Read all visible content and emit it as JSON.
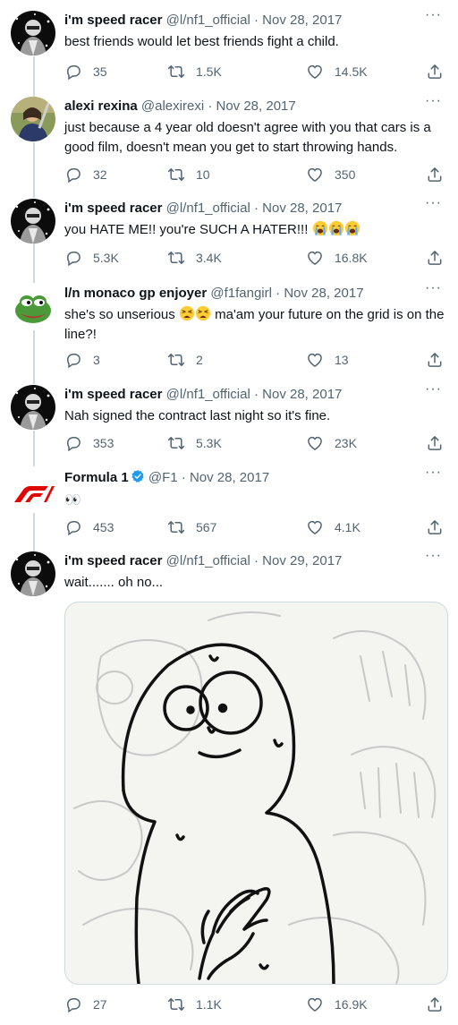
{
  "tweets": [
    {
      "name": "i'm speed racer",
      "handle": "@l/nf1_official",
      "sep": "·",
      "date": "Nov 28, 2017",
      "text": "best friends would let best friends fight a child.",
      "replies": "35",
      "retweets": "1.5K",
      "likes": "14.5K"
    },
    {
      "name": "alexi rexina",
      "handle": "@alexirexi",
      "sep": "·",
      "date": "Nov 28, 2017",
      "text": "just because a 4 year old doesn't agree with you that cars is a good film, doesn't mean you get to start throwing hands.",
      "replies": "32",
      "retweets": "10",
      "likes": "350"
    },
    {
      "name": "i'm speed racer",
      "handle": "@l/nf1_official",
      "sep": "·",
      "date": "Nov 28, 2017",
      "text": "you HATE ME!! you're SUCH A HATER!!!",
      "replies": "5.3K",
      "retweets": "3.4K",
      "likes": "16.8K"
    },
    {
      "name": "l/n monaco gp enjoyer",
      "handle": "@f1fangirl",
      "sep": "·",
      "date": "Nov 28, 2017",
      "text_a": "she's so unserious",
      "text_b": "ma'am your future on the grid is on the line?!",
      "replies": "3",
      "retweets": "2",
      "likes": "13"
    },
    {
      "name": "i'm speed racer",
      "handle": "@l/nf1_official",
      "sep": "·",
      "date": "Nov 28, 2017",
      "text": "Nah signed the contract last night so it's fine.",
      "replies": "353",
      "retweets": "5.3K",
      "likes": "23K"
    },
    {
      "name": "Formula 1",
      "handle": "@F1",
      "sep": "·",
      "date": "Nov 28, 2017",
      "text": "👀",
      "replies": "453",
      "retweets": "567",
      "likes": "4.1K"
    },
    {
      "name": "i'm speed racer",
      "handle": "@l/nf1_official",
      "sep": "·",
      "date": "Nov 29, 2017",
      "text": "wait....... oh no...",
      "replies": "27",
      "retweets": "1.1K",
      "likes": "16.9K"
    }
  ],
  "more_label": "···",
  "colors": {
    "text": "#0f1419",
    "muted": "#536471",
    "thread": "#cfd9de",
    "verified": "#1d9bf0",
    "f1_red": "#e10600"
  },
  "icons": [
    "reply-icon",
    "retweet-icon",
    "like-icon",
    "share-icon",
    "verified-badge-icon",
    "more-icon",
    "loudly-crying-face-emoji",
    "tired-face-emoji"
  ]
}
